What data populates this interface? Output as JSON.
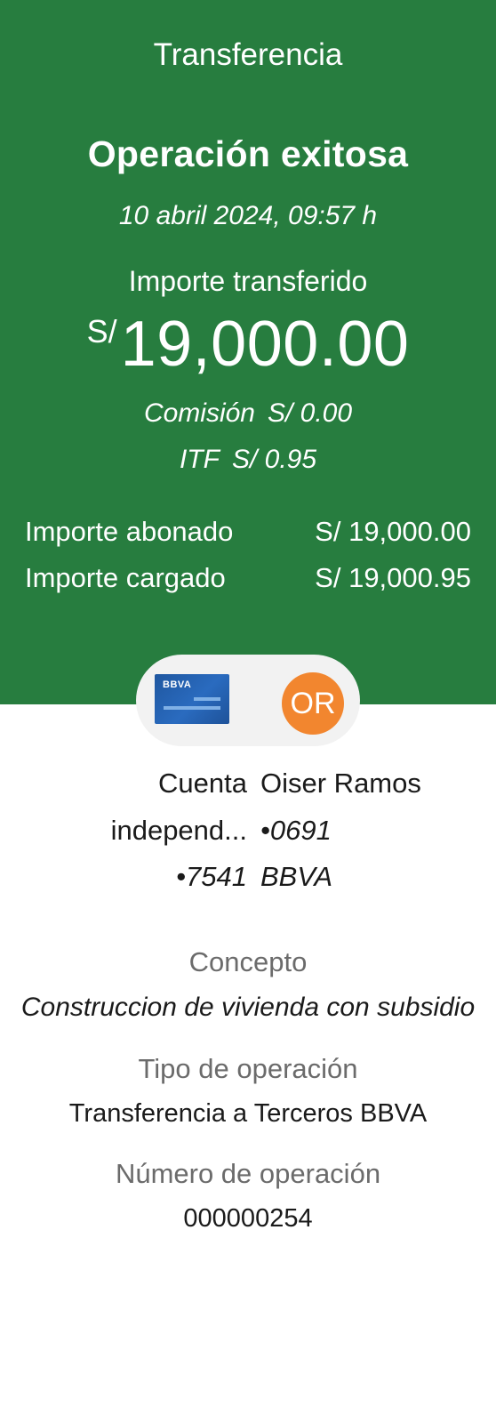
{
  "header": {
    "screen_title": "Transferencia",
    "status_title": "Operación exitosa",
    "datetime": "10 abril 2024, 09:57 h",
    "amount_label": "Importe transferido",
    "amount_currency": "S/",
    "amount_value": "19,000.00",
    "commission_label": "Comisión",
    "commission_value": "S/ 0.00",
    "itf_label": "ITF",
    "itf_value": "S/ 0.95",
    "summary": [
      {
        "label": "Importe abonado",
        "value": "S/ 19,000.00"
      },
      {
        "label": "Importe cargado",
        "value": "S/ 19,000.95"
      }
    ],
    "background_color": "#277d3f"
  },
  "parties": {
    "origin_logo_text": "BBVA",
    "destination_initials": "OR",
    "avatar_color": "#f2862f",
    "origin_lines": [
      "Cuenta",
      "independ...",
      "•7541"
    ],
    "destination_lines": [
      "Oiser Ramos",
      "•0691",
      "BBVA"
    ]
  },
  "details": {
    "concept_label": "Concepto",
    "concept_value": "Construccion de vivienda con subsidio",
    "type_label": "Tipo de operación",
    "type_value": "Transferencia a Terceros BBVA",
    "number_label": "Número de operación",
    "number_value": "000000254"
  }
}
